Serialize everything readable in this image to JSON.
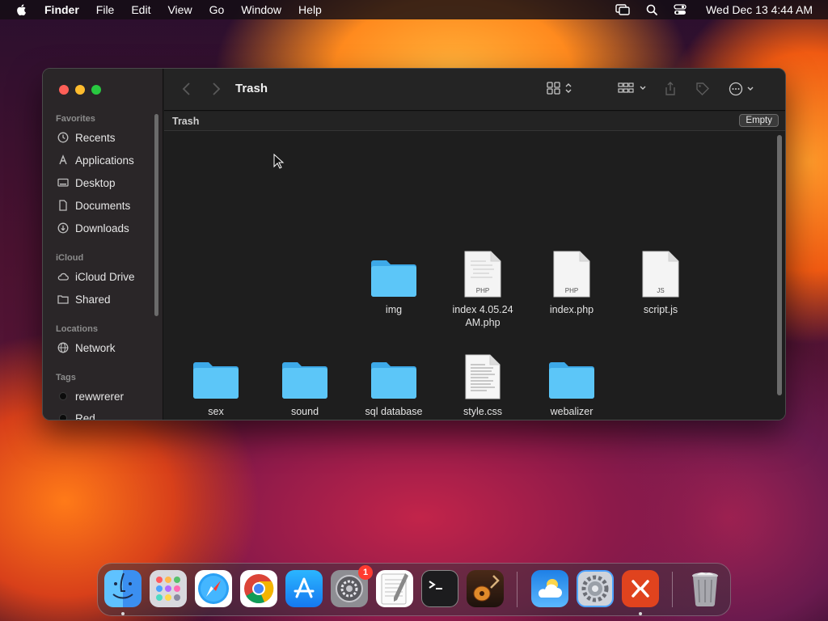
{
  "menubar": {
    "app_name": "Finder",
    "items": [
      "File",
      "Edit",
      "View",
      "Go",
      "Window",
      "Help"
    ],
    "clock": "Wed Dec 13  4:44 AM"
  },
  "window": {
    "title": "Trash",
    "path_location": "Trash",
    "empty_button": "Empty"
  },
  "sidebar": {
    "favorites_label": "Favorites",
    "favorites": [
      "Recents",
      "Applications",
      "Desktop",
      "Documents",
      "Downloads"
    ],
    "icloud_label": "iCloud",
    "icloud": [
      "iCloud Drive",
      "Shared"
    ],
    "locations_label": "Locations",
    "locations": [
      "Network"
    ],
    "tags_label": "Tags",
    "tags": [
      {
        "name": "rewwrerer",
        "color": "#1a1a1a"
      },
      {
        "name": "Red",
        "color": "#1a1a1a"
      }
    ]
  },
  "files": [
    {
      "name": "img",
      "kind": "folder"
    },
    {
      "name": "index 4.05.24 AM.php",
      "kind": "document",
      "badge": "PHP"
    },
    {
      "name": "index.php",
      "kind": "document",
      "badge": "PHP"
    },
    {
      "name": "script.js",
      "kind": "document",
      "badge": "JS"
    },
    {
      "name": "sex",
      "kind": "folder"
    },
    {
      "name": "sound",
      "kind": "folder"
    },
    {
      "name": "sql database",
      "kind": "folder"
    },
    {
      "name": "style.css",
      "kind": "text-document"
    },
    {
      "name": "webalizer",
      "kind": "folder"
    }
  ],
  "dock": {
    "apps": [
      "Finder",
      "Launchpad",
      "Safari",
      "Chrome",
      "App Store",
      "System Preferences",
      "TextEdit",
      "Terminal",
      "GarageBand",
      "Weather",
      "System Settings",
      "Remote Desktop",
      "Trash"
    ],
    "system_preferences_badge": "1"
  },
  "colors": {
    "folder": "#5ac8fa",
    "accent_red": "#ff5f57",
    "accent_yellow": "#febc2e",
    "accent_green": "#28c840"
  }
}
